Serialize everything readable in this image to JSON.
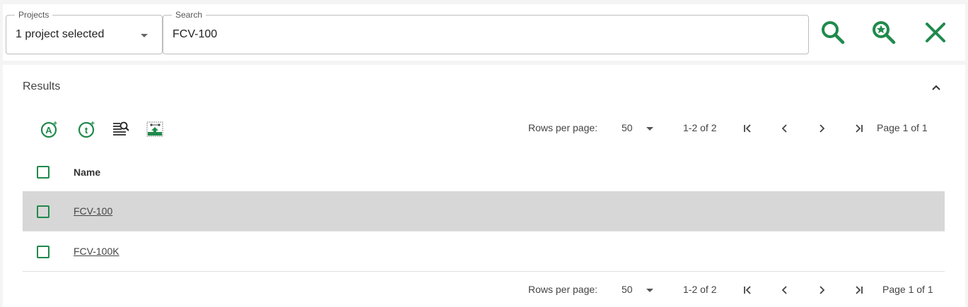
{
  "colors": {
    "accent": "#1f8a4c",
    "selected_row": "#d7d7d7"
  },
  "filters": {
    "projects": {
      "label": "Projects",
      "value": "1 project selected"
    },
    "search": {
      "label": "Search",
      "value": "FCV-100"
    }
  },
  "top_actions": [
    {
      "name": "search-icon"
    },
    {
      "name": "favorite-search-icon"
    },
    {
      "name": "clear-icon"
    }
  ],
  "results": {
    "title": "Results",
    "toolbar_icons": [
      "add-attribute-icon",
      "add-tag-icon",
      "search-list-icon",
      "export-image-icon"
    ],
    "pager": {
      "rows_per_page_label": "Rows per page:",
      "rows_per_page": "50",
      "range": "1-2 of 2",
      "page_label": "Page 1 of 1"
    },
    "columns": [
      "Name"
    ],
    "rows": [
      {
        "name": "FCV-100",
        "selected": true
      },
      {
        "name": "FCV-100K",
        "selected": false
      }
    ]
  }
}
